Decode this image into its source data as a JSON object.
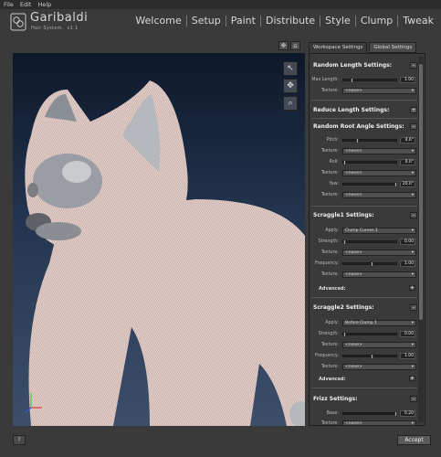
{
  "menu": [
    "File",
    "Edit",
    "Help"
  ],
  "logo": {
    "title": "Garibaldi",
    "subtitle": "Hair System.",
    "version": "v1.1"
  },
  "nav": {
    "tabs": [
      "Welcome",
      "Setup",
      "Paint",
      "Distribute",
      "Style",
      "Clump",
      "Tweak"
    ],
    "active": "Tweak"
  },
  "settings_tabs": [
    "Workspace Settings",
    "Global Settings"
  ],
  "sections": {
    "random_length": {
      "title": "Random Length Settings:",
      "max_length_label": "Max Length:",
      "max_length_value": "1.00",
      "texture_label": "Texture:",
      "texture_value": "<none>"
    },
    "reduce_length": {
      "title": "Reduce Length Settings:"
    },
    "random_root_angle": {
      "title": "Random Root Angle Settings:",
      "pitch_label": "Pitch:",
      "pitch_value": "4.6°",
      "texture1_label": "Texture:",
      "texture1_value": "<none>",
      "roll_label": "Roll:",
      "roll_value": "0.0°",
      "texture2_label": "Texture:",
      "texture2_value": "<none>",
      "yaw_label": "Yaw:",
      "yaw_value": "20.0°",
      "texture3_label": "Texture:",
      "texture3_value": "<none>"
    },
    "scraggle1": {
      "title": "Scraggle1 Settings:",
      "apply_label": "Apply:",
      "apply_value": "Clump Curves 1",
      "strength_label": "Strength:",
      "strength_value": "0.00",
      "texture1_label": "Texture:",
      "texture1_value": "<none>",
      "frequency_label": "Frequency:",
      "frequency_value": "1.00",
      "texture2_label": "Texture:",
      "texture2_value": "<none>",
      "advanced": "Advanced:"
    },
    "scraggle2": {
      "title": "Scraggle2 Settings:",
      "apply_label": "Apply:",
      "apply_value": "Before Clump 1",
      "strength_label": "Strength:",
      "strength_value": "0.00",
      "texture1_label": "Texture:",
      "texture1_value": "<none>",
      "frequency_label": "Frequency:",
      "frequency_value": "1.00",
      "texture2_label": "Texture:",
      "texture2_value": "<none>",
      "advanced": "Advanced:"
    },
    "frizz": {
      "title": "Frizz Settings:",
      "base_label": "Base:",
      "base_value": "0.20",
      "texture_label": "Texture:",
      "texture_value": "<none>"
    }
  },
  "buttons": {
    "help": "?",
    "accept": "Accept"
  },
  "colors": {
    "viewport_top": "#0d1829",
    "viewport_bottom": "#3c4f6a",
    "fur": "#d8c0bc",
    "panel_bg": "#3a3a3a"
  }
}
